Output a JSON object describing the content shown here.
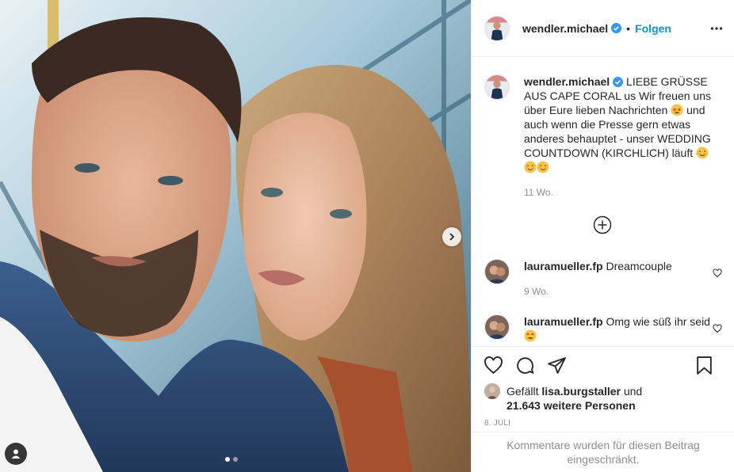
{
  "post": {
    "author": {
      "username": "wendler.michael",
      "verified": true,
      "follow_label": "Folgen",
      "separator": "•"
    },
    "carousel": {
      "slide_count": 2,
      "active_slide": 1
    },
    "caption": {
      "text_before_emoji": " LIEBE GRÜSSE AUS CAPE CORAL us Wir freuen uns über Eure lieben Nachrichten ",
      "text_mid": " und auch wenn die Presse gern etwas anderes behauptet - unser WEDDING COUNTDOWN (KIRCHLICH) läuft ",
      "emojis_mid": [
        "star-struck-emoji"
      ],
      "emojis_end": [
        "smiling-face-emoji",
        "smiling-face-emoji",
        "smiling-face-emoji"
      ],
      "time": "11 Wo."
    },
    "comments": [
      {
        "username": "lauramueller.fp",
        "text": "Dreamcouple",
        "time": "9 Wo."
      },
      {
        "username": "lauramueller.fp",
        "text": "Omg wie süß ihr seid",
        "emoji": "heart-eyes-emoji"
      }
    ],
    "likes": {
      "prefix": "Gefällt ",
      "liker": "lisa.burgstaller",
      "and": " und",
      "others": "21.643 weitere Personen"
    },
    "date": "8. JULI",
    "restricted_notice": "Kommentare wurden für diesen Beitrag eingeschränkt."
  },
  "colors": {
    "accent": "#0095f6",
    "text": "#262626",
    "muted": "#8e8e8e",
    "border": "#efefef",
    "verified": "#3897f0"
  }
}
